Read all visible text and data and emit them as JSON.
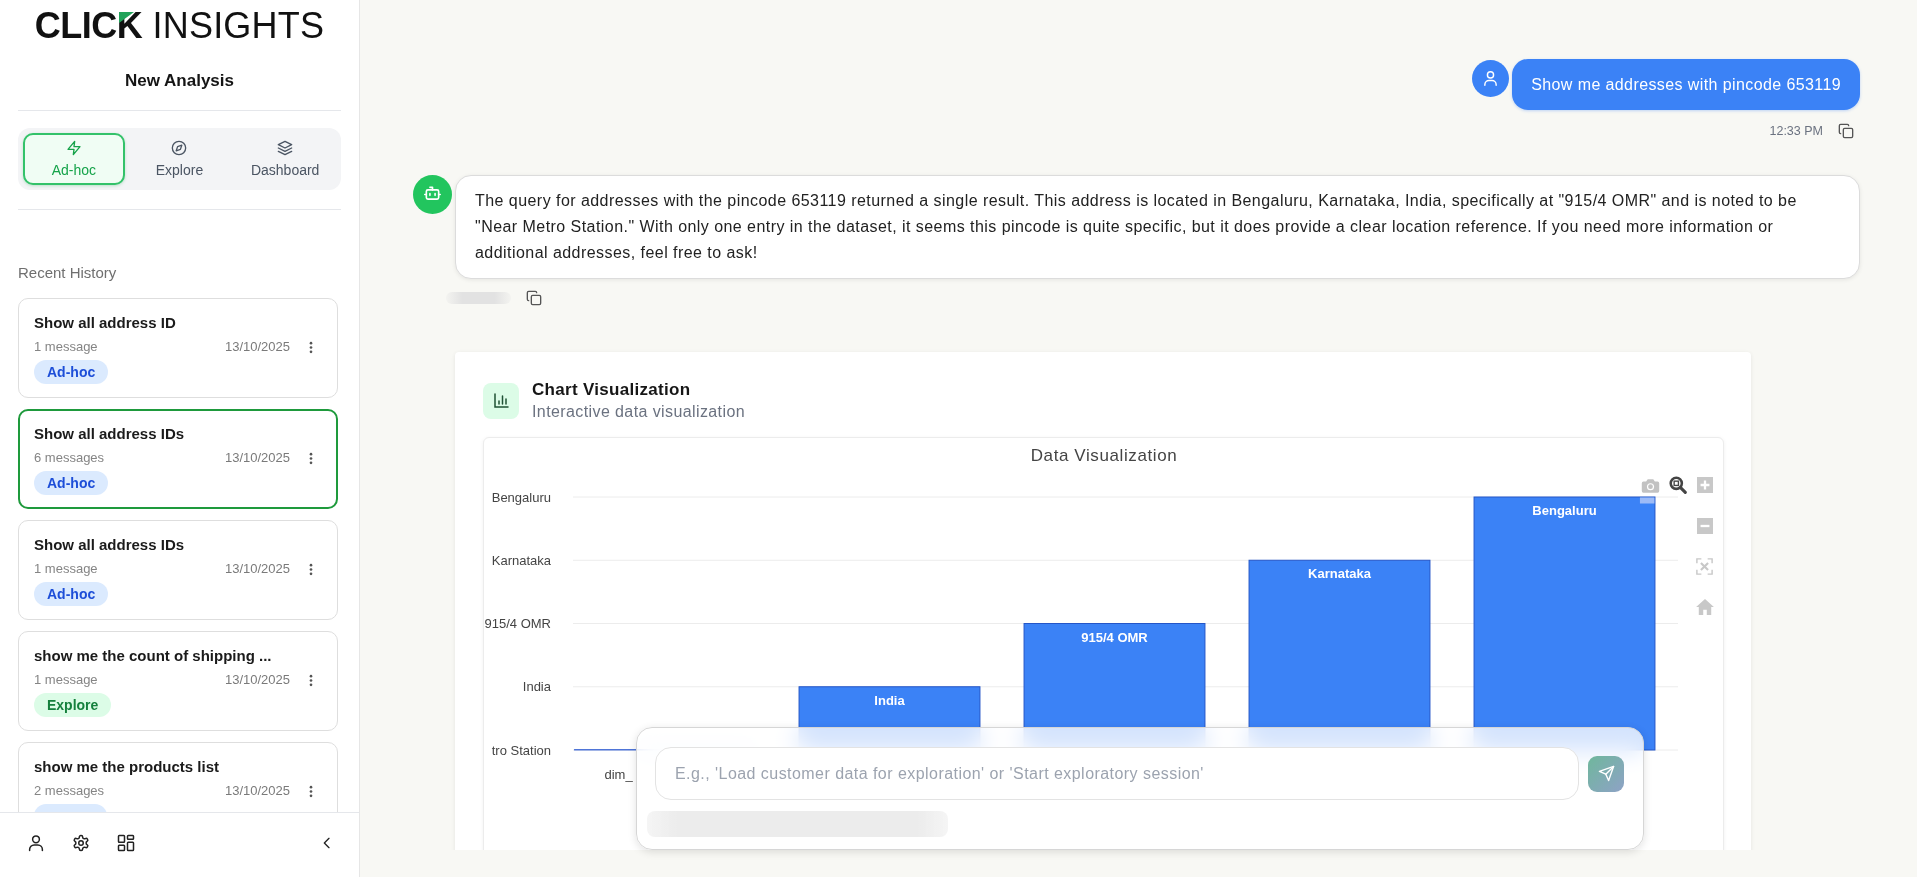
{
  "sidebar": {
    "brand": "**CLICK** INSIGHTS",
    "new_analysis": "New Analysis",
    "modes": [
      {
        "kind": "adhoc",
        "label": "Ad-hoc",
        "selected": true
      },
      {
        "kind": "explore",
        "label": "Explore",
        "selected": false
      },
      {
        "kind": "dashboard",
        "label": "Dashboard",
        "selected": false
      }
    ],
    "history_title": "Recent History",
    "history": [
      {
        "title": "Show all address ID",
        "count": "1 message",
        "date": "13/10/2025",
        "mode": {
          "kind": "adhoc",
          "label": "Ad-hoc"
        },
        "selected": false
      },
      {
        "title": "Show all address IDs",
        "count": "6 messages",
        "date": "13/10/2025",
        "mode": {
          "kind": "adhoc",
          "label": "Ad-hoc"
        },
        "selected": true
      },
      {
        "title": "Show all address IDs",
        "count": "1 message",
        "date": "13/10/2025",
        "mode": {
          "kind": "adhoc",
          "label": "Ad-hoc"
        },
        "selected": false
      },
      {
        "title": "show me the count of shipping ...",
        "count": "1 message",
        "date": "13/10/2025",
        "mode": {
          "kind": "explore",
          "label": "Explore"
        },
        "selected": false
      },
      {
        "title": "show me the products list",
        "count": "2 messages",
        "date": "13/10/2025",
        "mode": {
          "kind": "adhoc"
        },
        "selected": false
      }
    ]
  },
  "chat": {
    "messages": [
      {
        "kind": "user",
        "text": "Show me addresses with pincode 653119",
        "time": "12:33 PM"
      },
      {
        "kind": "assistant",
        "text": "The query for addresses with the pincode 653119 returned a single result. This address is located in Bengaluru, Karnataka, India, specifically at \"915/4 OMR\" and is noted to be \"Near Metro Station.\" With only one entry in the dataset, it seems this pincode is quite specific, but it does provide a clear location reference. If you need more information or additional addresses, feel free to ask!"
      }
    ]
  },
  "chart_card": {
    "title": "Chart Visualization",
    "subtitle": "Interactive data visualization",
    "plot": {
      "title": "Data Visualization",
      "y_axis_labels": [
        "Bengaluru",
        "Karnataka",
        "915/4 OMR",
        "India",
        "tro Station"
      ],
      "x_axis_labels": [
        "dim_"
      ],
      "bars": [
        {
          "kind": "flat"
        },
        {
          "kind": "bar",
          "label": "India"
        },
        {
          "kind": "bar",
          "label": "915/4 OMR"
        },
        {
          "kind": "bar",
          "label": "Karnataka"
        },
        {
          "kind": "bar",
          "label": "Bengaluru"
        }
      ]
    }
  },
  "composer": {
    "placeholder": "E.g., 'Load customer data for exploration' or 'Start exploratory session'"
  }
}
